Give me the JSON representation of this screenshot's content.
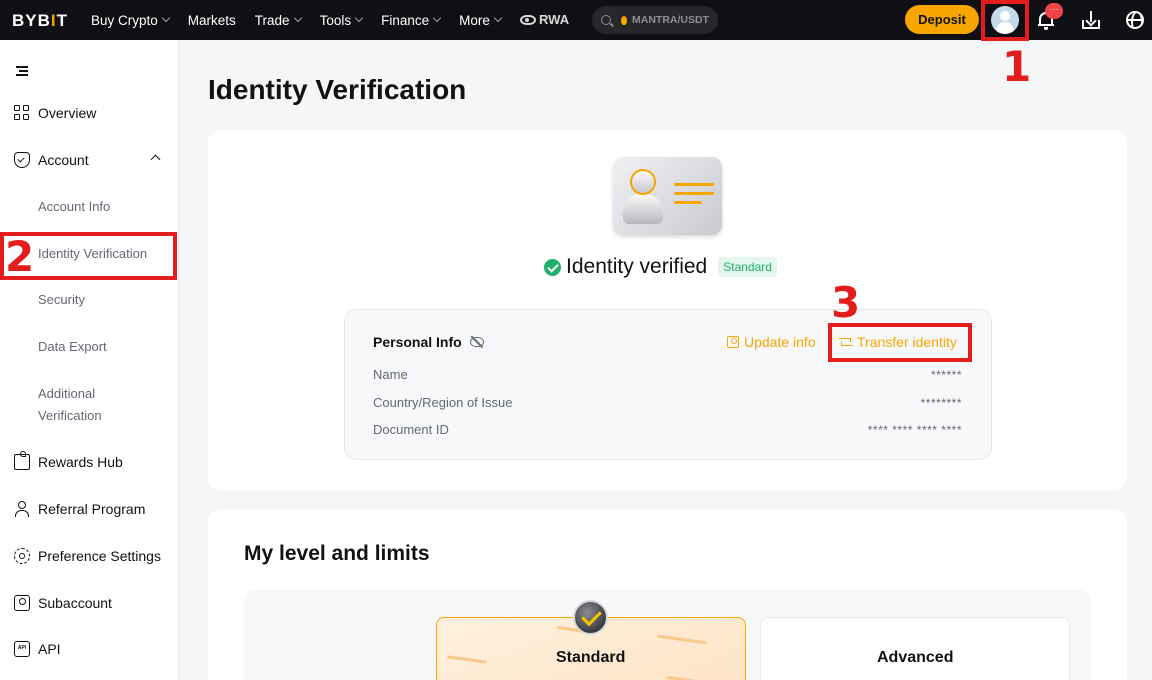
{
  "topbar": {
    "logo": "BYB",
    "logo_accent": "I",
    "logo_end": "T",
    "nav": [
      {
        "label": "Buy Crypto",
        "dropdown": true
      },
      {
        "label": "Markets",
        "dropdown": false
      },
      {
        "label": "Trade",
        "dropdown": true
      },
      {
        "label": "Tools",
        "dropdown": true
      },
      {
        "label": "Finance",
        "dropdown": true
      },
      {
        "label": "More",
        "dropdown": true
      }
    ],
    "rwa_label": "RWA",
    "search_text": "MANTRA/USDT",
    "deposit_label": "Deposit",
    "notification_badge": "···"
  },
  "annotations": {
    "one": "1",
    "two": "2",
    "three": "3"
  },
  "sidebar": {
    "overview": "Overview",
    "account": "Account",
    "account_sub": [
      "Account Info",
      "Identity Verification",
      "Security",
      "Data Export",
      "Additional Verification"
    ],
    "rewards": "Rewards Hub",
    "referral": "Referral Program",
    "preferences": "Preference Settings",
    "subaccount": "Subaccount",
    "api": "API"
  },
  "main": {
    "title": "Identity Verification",
    "status_text": "Identity verified",
    "level_badge": "Standard",
    "personal_info": {
      "title": "Personal Info",
      "update_label": "Update info",
      "transfer_label": "Transfer identity",
      "rows": [
        {
          "label": "Name",
          "value": "******"
        },
        {
          "label": "Country/Region of Issue",
          "value": "********"
        },
        {
          "label": "Document ID",
          "value": "**** **** **** ****"
        }
      ]
    },
    "limits": {
      "title": "My level and limits",
      "levels": [
        "Standard",
        "Advanced"
      ]
    }
  },
  "colors": {
    "brand": "#f7a600",
    "success": "#20b26c",
    "annotation": "#e31c1c",
    "topbar_bg": "#101014"
  },
  "icons": [
    "search-icon",
    "avatar-icon",
    "bell-icon",
    "download-icon",
    "globe-icon",
    "menu-collapse-icon",
    "overview-icon",
    "account-shield-icon",
    "rewards-gift-icon",
    "referral-person-icon",
    "preferences-gear-icon",
    "subaccount-icon",
    "api-icon",
    "eye-off-icon",
    "update-info-icon",
    "transfer-icon",
    "verified-check-icon",
    "standard-medal-icon"
  ]
}
